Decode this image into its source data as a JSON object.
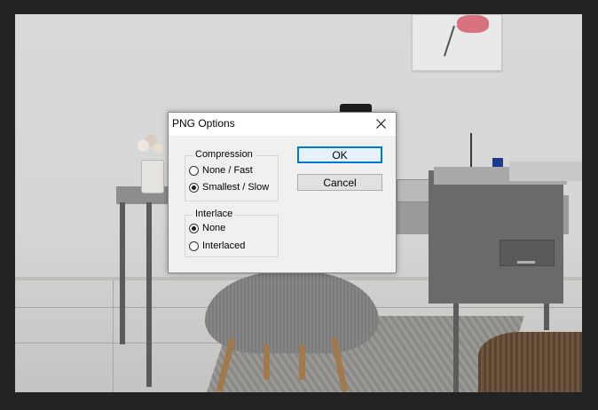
{
  "dialog": {
    "title": "PNG Options",
    "compression": {
      "label": "Compression",
      "options": [
        {
          "label": "None / Fast",
          "selected": false
        },
        {
          "label": "Smallest / Slow",
          "selected": true
        }
      ]
    },
    "interlace": {
      "label": "Interlace",
      "options": [
        {
          "label": "None",
          "selected": true
        },
        {
          "label": "Interlaced",
          "selected": false
        }
      ]
    },
    "ok_label": "OK",
    "cancel_label": "Cancel"
  },
  "colors": {
    "accent": "#0078d7",
    "dialog_bg": "#f0f0f0",
    "app_bg": "#232323"
  }
}
